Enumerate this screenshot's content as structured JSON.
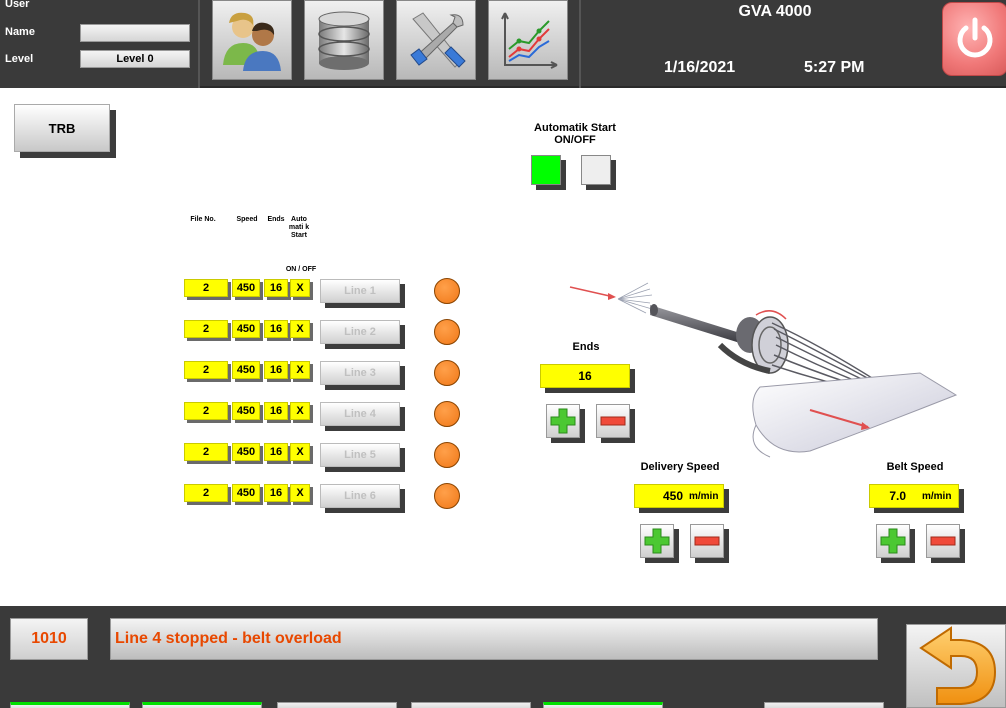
{
  "header": {
    "user_label": "User",
    "name_label": "Name",
    "name_value": "",
    "level_label": "Level",
    "level_value": "Level 0",
    "title": "GVA 4000",
    "date": "1/16/2021",
    "time": "5:27 PM",
    "nav_icons": [
      "users-icon",
      "database-icon",
      "tools-icon",
      "trend-chart-icon"
    ]
  },
  "trb_button": "TRB",
  "automatik": {
    "label_line1": "Automatik Start",
    "label_line2": "ON/OFF",
    "on_color": "#00ff00",
    "off_color": "#eeeeee"
  },
  "table": {
    "headers": {
      "file_no": "File No.",
      "speed": "Speed",
      "ends": "Ends",
      "auto_start": "Auto mati k Start",
      "on_off": "ON / OFF"
    },
    "rows": [
      {
        "file": "2",
        "speed": "450",
        "ends": "16",
        "auto": "X",
        "line": "Line 1"
      },
      {
        "file": "2",
        "speed": "450",
        "ends": "16",
        "auto": "X",
        "line": "Line 2"
      },
      {
        "file": "2",
        "speed": "450",
        "ends": "16",
        "auto": "X",
        "line": "Line 3"
      },
      {
        "file": "2",
        "speed": "450",
        "ends": "16",
        "auto": "X",
        "line": "Line 4"
      },
      {
        "file": "2",
        "speed": "450",
        "ends": "16",
        "auto": "X",
        "line": "Line 5"
      },
      {
        "file": "2",
        "speed": "450",
        "ends": "16",
        "auto": "X",
        "line": "Line 6"
      }
    ],
    "indicator_color": "#f07818"
  },
  "ends": {
    "label": "Ends",
    "value": "16"
  },
  "delivery_speed": {
    "label": "Delivery Speed",
    "value": "450",
    "unit": "m/min"
  },
  "belt_speed": {
    "label": "Belt Speed",
    "value": "7.0",
    "unit": "m/min"
  },
  "alarm": {
    "code": "1010",
    "message": "Line 4 stopped - belt overload",
    "color": "#e84800"
  }
}
